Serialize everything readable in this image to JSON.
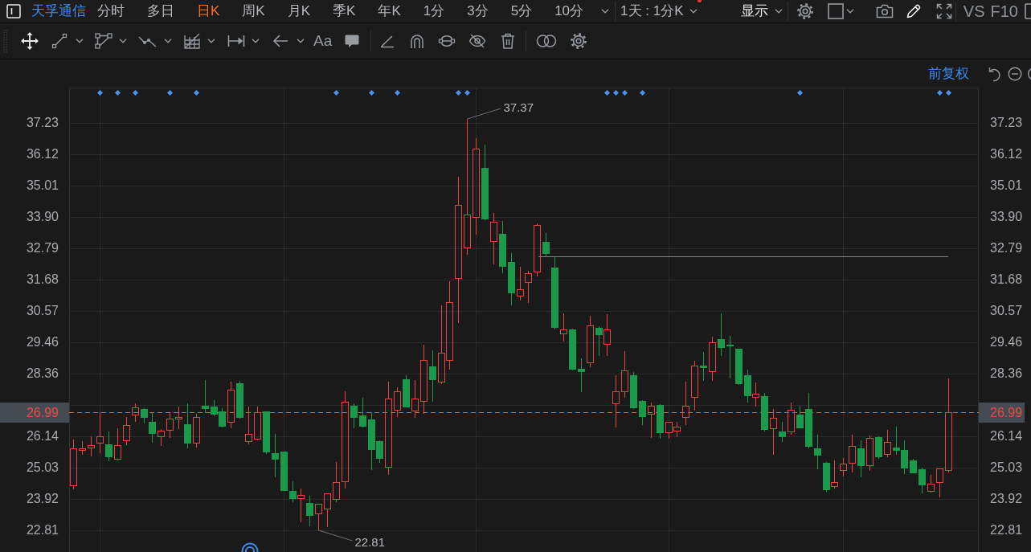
{
  "top_bar": {
    "stock_name": "天孚通信",
    "periods": [
      {
        "label": "分时",
        "selected": false
      },
      {
        "label": "多日",
        "selected": false
      },
      {
        "label": "日K",
        "selected": true
      },
      {
        "label": "周K",
        "selected": false
      },
      {
        "label": "月K",
        "selected": false
      },
      {
        "label": "季K",
        "selected": false
      },
      {
        "label": "年K",
        "selected": false
      },
      {
        "label": "1分",
        "selected": false
      },
      {
        "label": "3分",
        "selected": false
      },
      {
        "label": "5分",
        "selected": false
      },
      {
        "label": "10分",
        "selected": false
      }
    ],
    "interval": "1天 : 1分K",
    "display": "显示",
    "compare": "VS",
    "f10": "F10"
  },
  "drawing_toolbar": {
    "text_tool": "Aa"
  },
  "chart": {
    "adjustment": "前复权",
    "left_axis": {
      "current_price": "26.99"
    },
    "right_axis": {
      "labels": [
        "37.23",
        "36.12",
        "35.01",
        "33.90",
        "32.79",
        "31.68",
        "30.57",
        "29.46",
        "28.36",
        "26.14",
        "25.03",
        "23.92",
        "22.81"
      ],
      "current_price": "26.99"
    },
    "chart_data": {
      "type": "candlestick",
      "categories": [
        null,
        null,
        null,
        null,
        null,
        null,
        null,
        null,
        null,
        null,
        null,
        null,
        null,
        null,
        null,
        null,
        null,
        null,
        null,
        null,
        null,
        null,
        null,
        null,
        null,
        null,
        null,
        null,
        null,
        null,
        null,
        null,
        null,
        null,
        null,
        null,
        null,
        null,
        null,
        null,
        null,
        null,
        null,
        null,
        null,
        null,
        null,
        null,
        null,
        null,
        null,
        null,
        null,
        null,
        null,
        null,
        null,
        null,
        null,
        null,
        null,
        null,
        null,
        null,
        null,
        null,
        null,
        null,
        null,
        null,
        null,
        null,
        null,
        null,
        null,
        null,
        null,
        null,
        null,
        null,
        null,
        null,
        null,
        null,
        null,
        null,
        null,
        null,
        null,
        null,
        null,
        null,
        null,
        null,
        null,
        null,
        null,
        null,
        null,
        null,
        null,
        null,
        null,
        null
      ],
      "ohlc": [
        [
          24.37,
          26.02,
          24.25,
          25.7
        ],
        [
          25.62,
          25.96,
          25.48,
          25.7
        ],
        [
          25.7,
          26.13,
          25.42,
          25.82
        ],
        [
          25.87,
          26.98,
          25.53,
          26.13
        ],
        [
          25.85,
          26.3,
          25.25,
          25.39
        ],
        [
          25.3,
          26.41,
          25.28,
          25.82
        ],
        [
          25.96,
          26.81,
          25.82,
          26.53
        ],
        [
          26.87,
          27.3,
          26.64,
          27.15
        ],
        [
          27.1,
          27.13,
          26.59,
          26.78
        ],
        [
          26.64,
          26.98,
          25.9,
          26.22
        ],
        [
          26.1,
          26.39,
          25.79,
          26.33
        ],
        [
          26.33,
          26.96,
          26.07,
          26.76
        ],
        [
          26.73,
          27.18,
          26.39,
          26.81
        ],
        [
          26.56,
          27.3,
          25.7,
          25.87
        ],
        [
          25.87,
          26.93,
          25.73,
          26.81
        ],
        [
          27.21,
          28.12,
          26.96,
          27.1
        ],
        [
          27.18,
          27.41,
          26.84,
          26.9
        ],
        [
          27.01,
          27.13,
          26.44,
          26.47
        ],
        [
          26.61,
          28.07,
          26.41,
          27.78
        ],
        [
          28.01,
          28.09,
          26.76,
          26.78
        ],
        [
          25.93,
          27.18,
          25.85,
          26.22
        ],
        [
          26.02,
          27.18,
          25.99,
          26.98
        ],
        [
          27.01,
          27.01,
          25.5,
          25.56
        ],
        [
          25.53,
          26.22,
          24.68,
          25.3
        ],
        [
          25.59,
          25.59,
          24.19,
          24.19
        ],
        [
          24.19,
          24.54,
          23.8,
          23.91
        ],
        [
          23.91,
          24.28,
          23.08,
          24.05
        ],
        [
          23.77,
          24.02,
          22.94,
          23.31
        ],
        [
          23.37,
          23.74,
          22.81,
          23.74
        ],
        [
          23.54,
          24.11,
          22.91,
          24.11
        ],
        [
          23.88,
          25.22,
          23.8,
          24.51
        ],
        [
          24.51,
          27.72,
          24.28,
          27.35
        ],
        [
          27.21,
          27.3,
          26.41,
          26.78
        ],
        [
          26.87,
          27.5,
          26.44,
          26.47
        ],
        [
          26.73,
          26.98,
          24.93,
          25.65
        ],
        [
          25.96,
          25.99,
          25.19,
          25.33
        ],
        [
          25.02,
          28.07,
          24.76,
          27.47
        ],
        [
          27.04,
          27.87,
          26.81,
          27.72
        ],
        [
          28.15,
          28.29,
          27.15,
          27.15
        ],
        [
          27.01,
          28.12,
          26.78,
          27.47
        ],
        [
          27.35,
          29.37,
          26.93,
          28.83
        ],
        [
          28.61,
          29.18,
          27.35,
          28.12
        ],
        [
          28.04,
          30.77,
          27.98,
          29.09
        ],
        [
          28.81,
          31.62,
          28.49,
          30.88
        ],
        [
          31.71,
          35.32,
          30.14,
          34.33
        ],
        [
          32.79,
          37.37,
          32.56,
          33.99
        ],
        [
          33.87,
          36.69,
          33.27,
          36.32
        ],
        [
          35.64,
          36.46,
          33.79,
          33.81
        ],
        [
          33.02,
          34.04,
          32.22,
          33.73
        ],
        [
          33.3,
          33.76,
          31.91,
          32.14
        ],
        [
          32.31,
          32.62,
          30.77,
          31.2
        ],
        [
          31.08,
          32.14,
          30.94,
          31.34
        ],
        [
          31.57,
          31.99,
          30.85,
          31.91
        ],
        [
          31.94,
          33.67,
          31.79,
          33.62
        ],
        [
          33.02,
          33.33,
          32.48,
          32.59
        ],
        [
          32.11,
          32.51,
          29.92,
          29.97
        ],
        [
          29.74,
          30.48,
          29.49,
          29.92
        ],
        [
          29.92,
          29.94,
          28.46,
          28.49
        ],
        [
          28.52,
          28.89,
          27.7,
          28.41
        ],
        [
          28.72,
          30.4,
          28.58,
          30.06
        ],
        [
          29.97,
          30.03,
          28.98,
          29.72
        ],
        [
          29.37,
          30.46,
          28.98,
          29.92
        ],
        [
          27.27,
          28.29,
          26.44,
          27.72
        ],
        [
          27.7,
          29.15,
          27.5,
          28.46
        ],
        [
          28.29,
          28.41,
          27.1,
          27.13
        ],
        [
          27.38,
          27.41,
          26.53,
          26.81
        ],
        [
          26.9,
          27.33,
          26.07,
          27.21
        ],
        [
          27.24,
          27.27,
          26.04,
          26.24
        ],
        [
          26.24,
          26.64,
          26.04,
          26.64
        ],
        [
          26.3,
          26.64,
          26.1,
          26.47
        ],
        [
          26.78,
          28.07,
          26.53,
          27.21
        ],
        [
          27.5,
          28.81,
          27.04,
          28.63
        ],
        [
          28.63,
          29.12,
          28.09,
          28.55
        ],
        [
          28.41,
          29.66,
          28.09,
          29.46
        ],
        [
          29.57,
          30.48,
          28.98,
          29.26
        ],
        [
          29.37,
          29.69,
          28.18,
          29.32
        ],
        [
          29.23,
          29.23,
          27.95,
          27.98
        ],
        [
          28.29,
          28.49,
          27.33,
          27.55
        ],
        [
          27.5,
          28.04,
          27.18,
          27.64
        ],
        [
          27.55,
          27.67,
          26.3,
          26.36
        ],
        [
          26.39,
          27.1,
          25.48,
          26.78
        ],
        [
          26.3,
          26.64,
          25.93,
          26.1
        ],
        [
          26.27,
          27.33,
          26.19,
          27.07
        ],
        [
          26.9,
          27.21,
          26.41,
          26.41
        ],
        [
          27.1,
          27.67,
          25.7,
          25.76
        ],
        [
          25.7,
          26.19,
          24.96,
          25.45
        ],
        [
          25.19,
          25.22,
          24.17,
          24.22
        ],
        [
          24.34,
          25.28,
          24.28,
          24.51
        ],
        [
          24.91,
          25.36,
          24.71,
          25.16
        ],
        [
          25.16,
          26.19,
          24.85,
          25.79
        ],
        [
          25.7,
          25.99,
          24.68,
          25.08
        ],
        [
          25.08,
          26.16,
          24.91,
          26.07
        ],
        [
          26.1,
          26.13,
          25.33,
          25.39
        ],
        [
          25.48,
          26.36,
          25.39,
          25.93
        ],
        [
          25.73,
          26.47,
          25.48,
          25.62
        ],
        [
          25.65,
          25.99,
          24.79,
          24.99
        ],
        [
          25.28,
          25.33,
          24.82,
          24.82
        ],
        [
          24.96,
          25.02,
          24.11,
          24.39
        ],
        [
          24.17,
          24.76,
          24.14,
          24.45
        ],
        [
          24.48,
          24.99,
          23.97,
          24.99
        ],
        [
          24.91,
          28.18,
          24.85,
          26.99
        ],
        null,
        null,
        null
      ],
      "ylim": [
        22.03,
        38.48
      ],
      "yticks": [
        37.23,
        36.12,
        35.01,
        {
          "value": 33.9,
          "label": "33.90"
        },
        32.79,
        31.68,
        30.57,
        29.46,
        28.36,
        26.14,
        25.03,
        23.92,
        22.81
      ],
      "grid": true,
      "annotations": [
        "37.37",
        "22.81"
      ],
      "ref_lines": [
        {
          "axis": "y",
          "value": 26.99
        },
        {
          "axis": "y",
          "value": 32.49
        }
      ]
    }
  }
}
